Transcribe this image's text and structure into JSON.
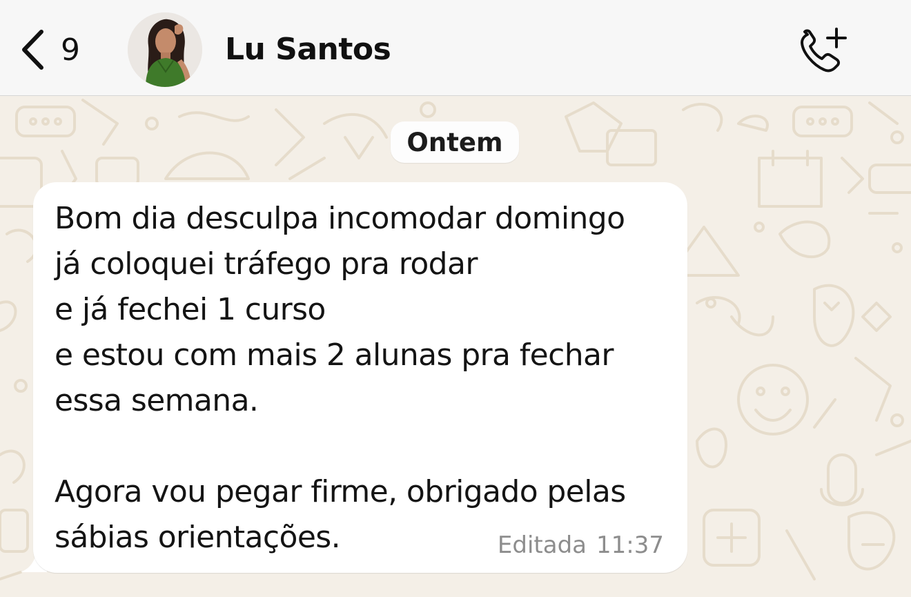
{
  "header": {
    "back_icon": "chevron-left-icon",
    "unread_count": "9",
    "contact_name": "Lu Santos",
    "call_icon": "phone-add-icon"
  },
  "chat": {
    "date_label": "Ontem",
    "messages": [
      {
        "lines": [
          "Bom dia desculpa incomodar domingo",
          "já coloquei tráfego pra rodar",
          "e já fechei 1 curso",
          "e estou com mais 2 alunas pra fechar",
          "essa semana.",
          "",
          "Agora vou pegar firme, obrigado pelas",
          "sábias orientações."
        ],
        "edited_label": "Editada",
        "time": "11:37"
      }
    ]
  },
  "colors": {
    "header_bg": "#f7f7f7",
    "wallpaper_bg": "#f4efe7",
    "wallpaper_doodle": "#e6dccb",
    "bubble_bg": "#ffffff",
    "meta_text": "#8d8d8d"
  }
}
